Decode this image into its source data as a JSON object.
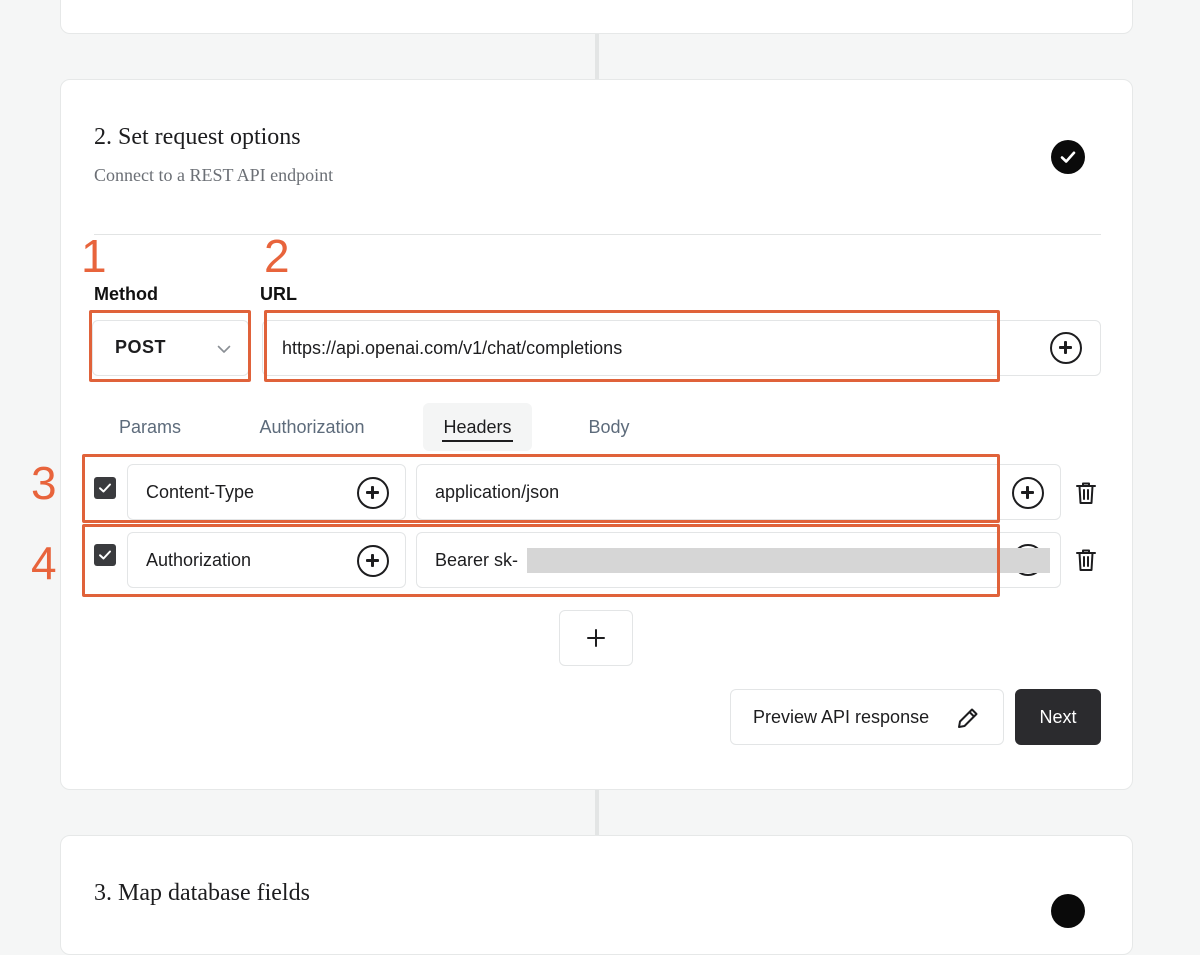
{
  "step2": {
    "title": "2. Set request options",
    "subtitle": "Connect to a REST API endpoint",
    "annotations": [
      "1",
      "2",
      "3",
      "4"
    ],
    "method": {
      "label": "Method",
      "value": "POST"
    },
    "url": {
      "label": "URL",
      "value": "https://api.openai.com/v1/chat/completions"
    },
    "tabs": [
      {
        "label": "Params"
      },
      {
        "label": "Authorization"
      },
      {
        "label": "Headers",
        "active": true
      },
      {
        "label": "Body"
      }
    ],
    "headers": [
      {
        "checked": true,
        "key": "Content-Type",
        "value": "application/json"
      },
      {
        "checked": true,
        "key": "Authorization",
        "value": "Bearer sk-"
      }
    ],
    "preview_label": "Preview API response",
    "next_label": "Next"
  },
  "step3": {
    "title": "3. Map database fields"
  },
  "colors": {
    "annotation": "#e0623a",
    "primary_button": "#2b2b2e",
    "background": "#f5f6f6"
  },
  "icons": [
    "check-icon",
    "chevron-down-icon",
    "plus-circle-icon",
    "checkbox-check-icon",
    "trash-icon",
    "plus-icon",
    "pencil-icon"
  ]
}
